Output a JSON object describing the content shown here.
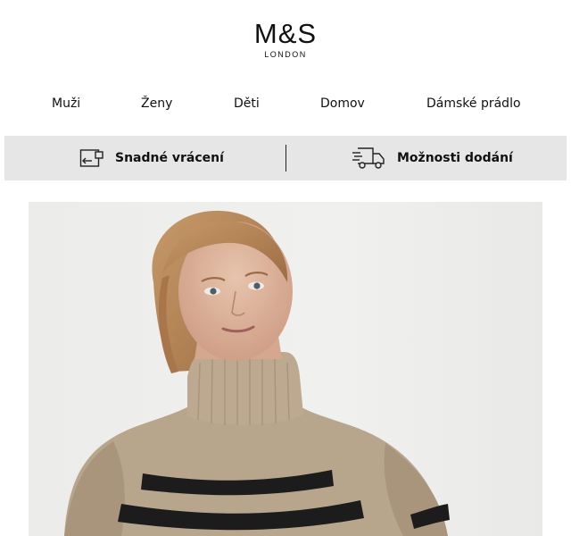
{
  "brand": {
    "logo": "M&S",
    "tagline": "LONDON"
  },
  "nav": {
    "items": [
      {
        "label": "Muži"
      },
      {
        "label": "Ženy"
      },
      {
        "label": "Děti"
      },
      {
        "label": "Domov"
      },
      {
        "label": "Dámské prádlo"
      }
    ]
  },
  "benefits": {
    "returns_label": "Snadné vrácení",
    "returns_icon": "return-box-icon",
    "delivery_label": "Možnosti dodání",
    "delivery_icon": "delivery-truck-icon"
  },
  "colors": {
    "benefit_bar_bg": "#e6e6e6",
    "sweater_beige": "#b7a58c",
    "stripe_black": "#1c1c1c"
  }
}
